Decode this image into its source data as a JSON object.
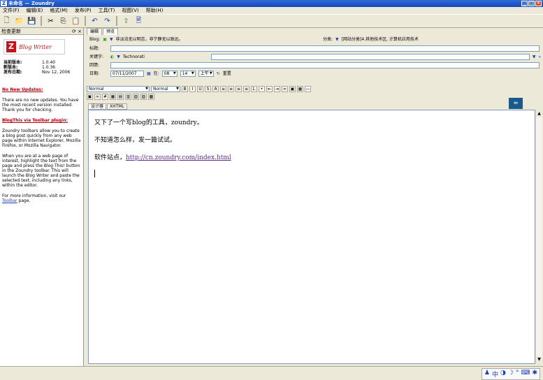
{
  "window": {
    "title": "未命名 — Zoundry",
    "icon": "Z"
  },
  "menu": [
    "文件(F)",
    "编辑(E)",
    "格式(M)",
    "发布(P)",
    "工具(T)",
    "视图(V)",
    "帮助(H)"
  ],
  "toolbar_icons": [
    "new-doc-icon",
    "open-folder-icon",
    "save-icon",
    "cut-icon",
    "copy-icon",
    "paste-icon",
    "undo-icon",
    "redo-icon",
    "publish-icon",
    "preview-icon"
  ],
  "left_panel": {
    "title": "检查更新",
    "logo_text": "Blog Writer",
    "current_version_label": "当前版本:",
    "current_version": "1.0.40",
    "new_version_label": "新版本:",
    "new_version": "1.0.36",
    "release_date_label": "发布日期:",
    "release_date": "Nov 12, 2006",
    "no_updates_heading": "No New Updates:",
    "no_updates_text": "There are no new updates. You have the most recent version installed. Thank you for checking.",
    "blogthis_heading": "BlogThis via Toolbar plugin:",
    "blogthis_text1": "Zoundry toolbars allow you to create a blog post quickly from any web page within Internet Explorer, Mozilla Firefox, or Mozilla Navigator.",
    "blogthis_text2": "When you are at a web page of interest, highlight the text from the page and press the Blog This! button in the Zoundry toolbar. This will launch the Blog Writer and paste the selected text, including any links, within the editor.",
    "more_info_prefix": "For more information, visit our",
    "more_info_link": "Toolbar",
    "more_info_suffix": "page."
  },
  "editor_tabs": [
    "编辑",
    "预览"
  ],
  "props": {
    "blog_label": "Blog:",
    "blog_value": "非淡泊无以明志，非宁静无以致远。",
    "category_label": "分类:",
    "category_value": "[网站分类]4.其他技术区, 计算机应用技术",
    "title_label": "标题:",
    "title_value": "",
    "tags_label": "关键字:",
    "tags_value": "Technorati",
    "trackback_label": "回馈:",
    "trackback_value": "",
    "date_label": "日期:",
    "date_value": "07/11/2007",
    "at_label": "在:",
    "hour": "08",
    "minute": "14",
    "ampm": "上午",
    "reset_label": "重置"
  },
  "format": {
    "style_select": "Normal",
    "font_select": "Normal"
  },
  "mode_tabs": [
    "设计器",
    "XHTML"
  ],
  "document": {
    "line1": "又下了一个写blog的工具，zoundry。",
    "line2": "不知道怎么样，发一篇试试。",
    "line3_prefix": "软件站点，",
    "line3_link": "http://cn.zoundry.com/index.html"
  }
}
